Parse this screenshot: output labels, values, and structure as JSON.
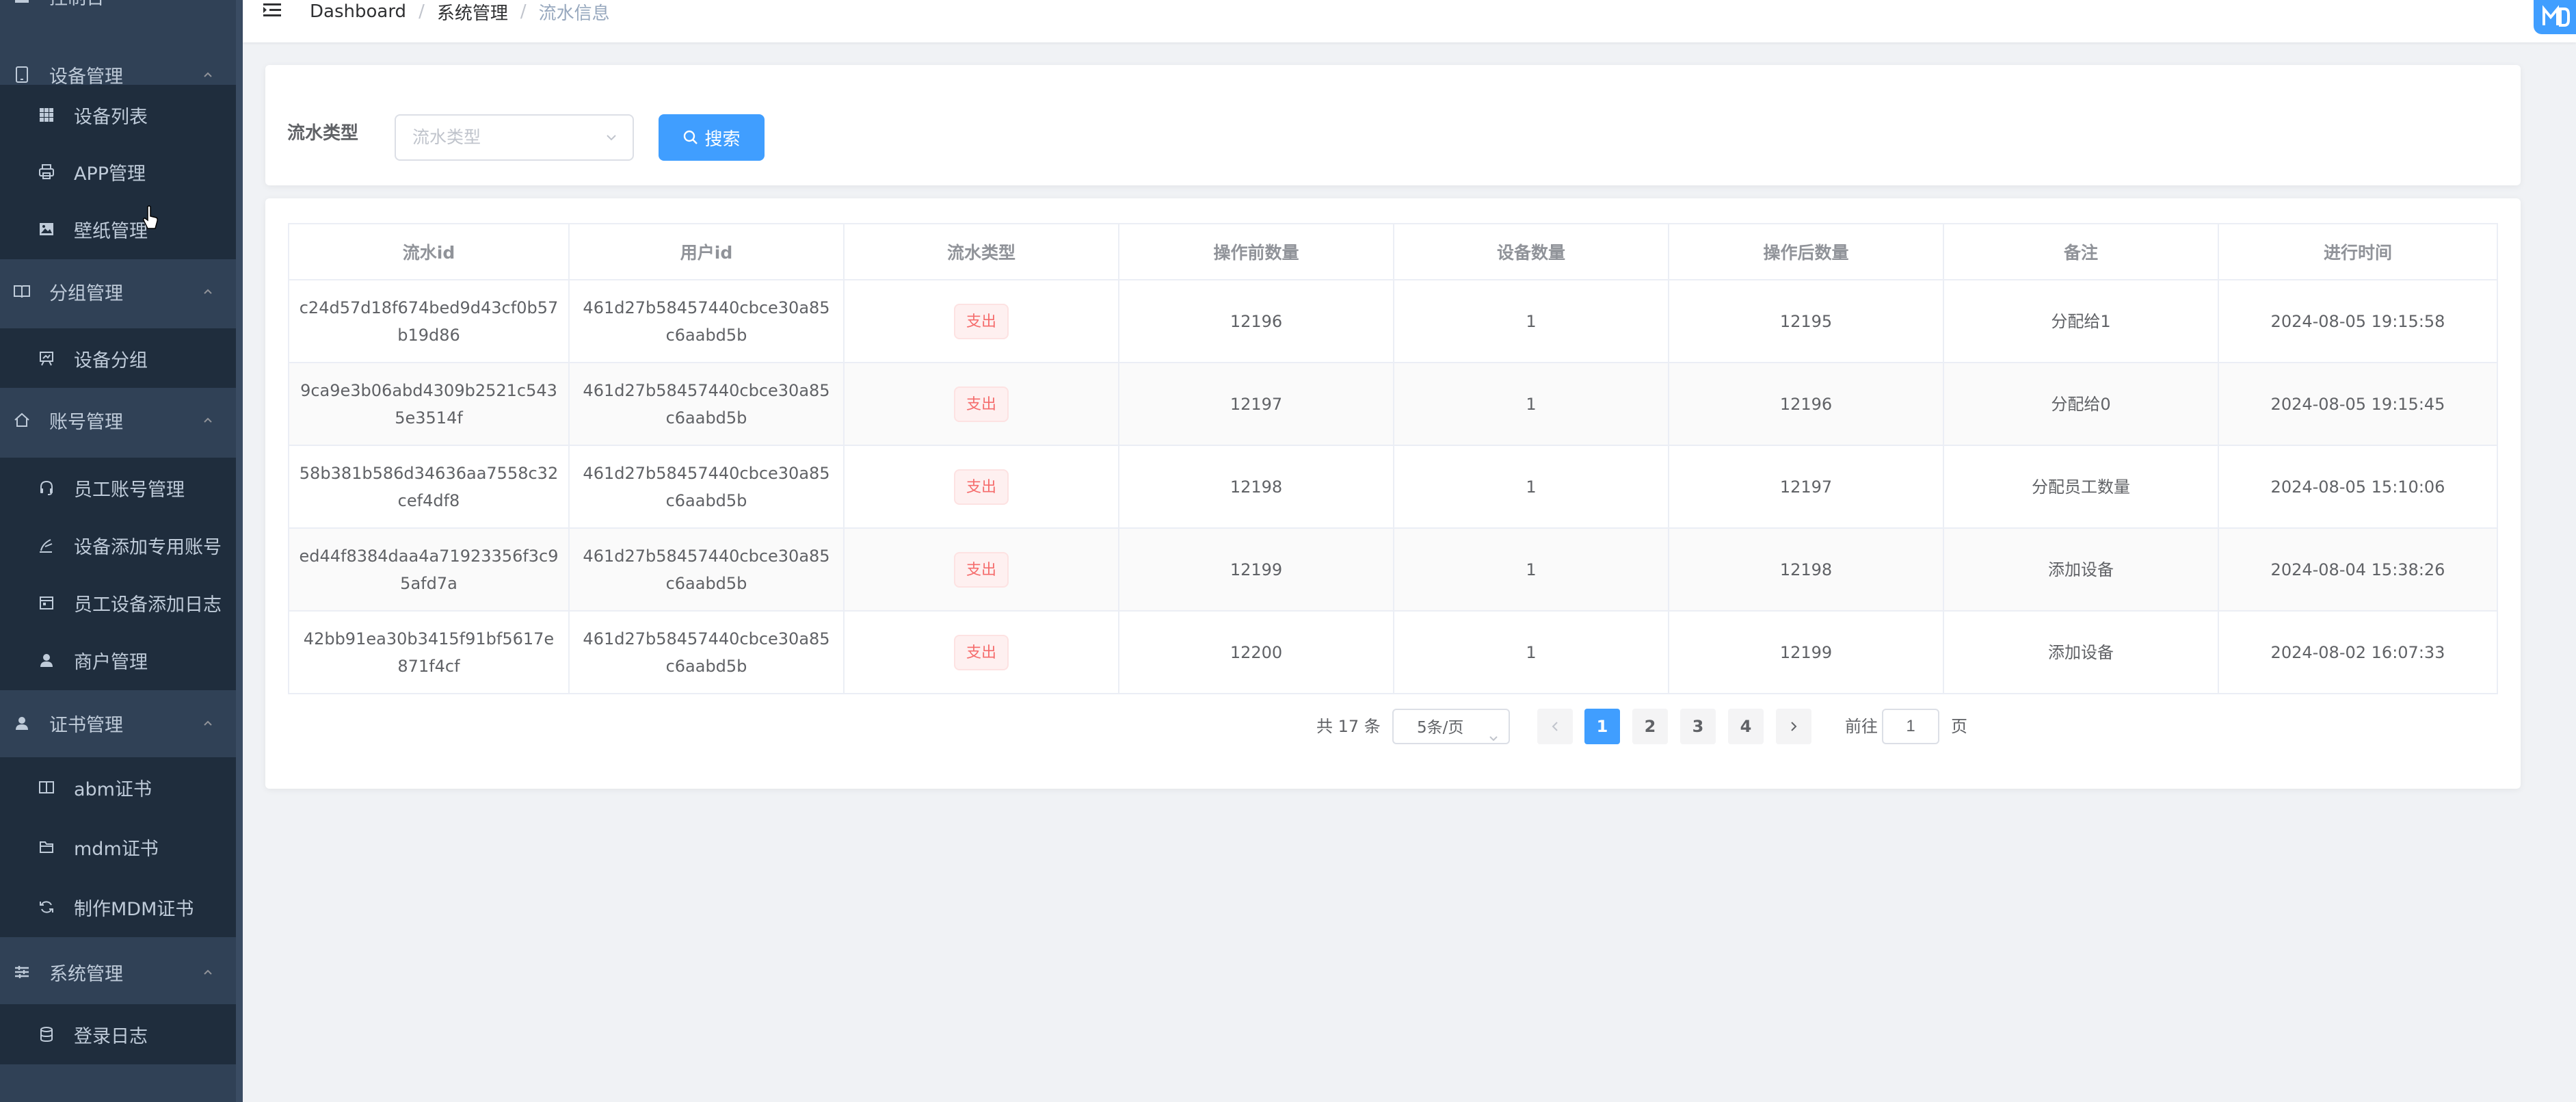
{
  "sidebar": {
    "top_label": "控制台",
    "items": [
      {
        "type": "group",
        "label": "设备管理",
        "icon": "tablet-icon"
      },
      {
        "type": "item",
        "label": "设备列表",
        "icon": "grid-icon"
      },
      {
        "type": "item",
        "label": "APP管理",
        "icon": "printer-icon"
      },
      {
        "type": "item",
        "label": "壁纸管理",
        "icon": "picture-icon"
      },
      {
        "type": "group",
        "label": "分组管理",
        "icon": "book-open-icon"
      },
      {
        "type": "item",
        "label": "设备分组",
        "icon": "easel-icon"
      },
      {
        "type": "group",
        "label": "账号管理",
        "icon": "house-icon"
      },
      {
        "type": "item",
        "label": "员工账号管理",
        "icon": "headset-icon"
      },
      {
        "type": "item",
        "label": "设备添加专用账号",
        "icon": "pen-icon"
      },
      {
        "type": "item",
        "label": "员工设备添加日志",
        "icon": "calendar-icon"
      },
      {
        "type": "item",
        "label": "商户管理",
        "icon": "user-icon"
      },
      {
        "type": "group",
        "label": "证书管理",
        "icon": "user-icon"
      },
      {
        "type": "item",
        "label": "abm证书",
        "icon": "book-icon"
      },
      {
        "type": "item",
        "label": "mdm证书",
        "icon": "folder-icon"
      },
      {
        "type": "item",
        "label": "制作MDM证书",
        "icon": "refresh-icon"
      },
      {
        "type": "group",
        "label": "系统管理",
        "icon": "sliders-icon"
      },
      {
        "type": "item",
        "label": "登录日志",
        "icon": "database-icon"
      }
    ]
  },
  "breadcrumb": [
    "Dashboard",
    "系统管理",
    "流水信息"
  ],
  "filter": {
    "label": "流水类型",
    "select_placeholder": "流水类型",
    "search_label": "搜索"
  },
  "table": {
    "columns": [
      "流水id",
      "用户id",
      "流水类型",
      "操作前数量",
      "设备数量",
      "操作后数量",
      "备注",
      "进行时间"
    ],
    "rows": [
      {
        "id": "c24d57d18f674bed9d43cf0b57b19d86",
        "user": "461d27b58457440cbce30a85c6aabd5b",
        "type": "支出",
        "before": "12196",
        "count": "1",
        "after": "12195",
        "note": "分配给1",
        "time": "2024-08-05 19:15:58"
      },
      {
        "id": "9ca9e3b06abd4309b2521c5435e3514f",
        "user": "461d27b58457440cbce30a85c6aabd5b",
        "type": "支出",
        "before": "12197",
        "count": "1",
        "after": "12196",
        "note": "分配给0",
        "time": "2024-08-05 19:15:45"
      },
      {
        "id": "58b381b586d34636aa7558c32cef4df8",
        "user": "461d27b58457440cbce30a85c6aabd5b",
        "type": "支出",
        "before": "12198",
        "count": "1",
        "after": "12197",
        "note": "分配员工数量",
        "time": "2024-08-05 15:10:06"
      },
      {
        "id": "ed44f8384daa4a71923356f3c95afd7a",
        "user": "461d27b58457440cbce30a85c6aabd5b",
        "type": "支出",
        "before": "12199",
        "count": "1",
        "after": "12198",
        "note": "添加设备",
        "time": "2024-08-04 15:38:26"
      },
      {
        "id": "42bb91ea30b3415f91bf5617e871f4cf",
        "user": "461d27b58457440cbce30a85c6aabd5b",
        "type": "支出",
        "before": "12200",
        "count": "1",
        "after": "12199",
        "note": "添加设备",
        "time": "2024-08-02 16:07:33"
      }
    ]
  },
  "pagination": {
    "total_text": "共 17 条",
    "page_size": "5条/页",
    "pages": [
      "1",
      "2",
      "3",
      "4"
    ],
    "current_page": "1",
    "goto_label": "前往",
    "goto_value": "1",
    "goto_unit": "页"
  },
  "colors": {
    "sidebar_bg": "#304156",
    "submenu_bg": "#1f2d3d",
    "primary": "#409eff",
    "danger": "#f56c6c"
  }
}
